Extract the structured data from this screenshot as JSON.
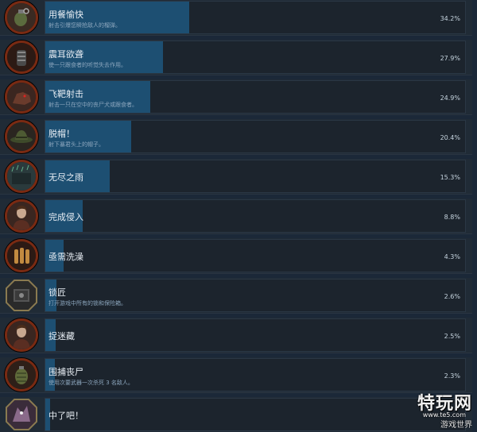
{
  "achievements": [
    {
      "name": "用餐愉快",
      "desc": "射击引爆您瞬抢敌人的榴弹。",
      "pct": "34.2%",
      "progress": 0.342,
      "icon": "hand-grenade-icon",
      "frame": "red"
    },
    {
      "name": "震耳欲聋",
      "desc": "使一只跟食者的听觉失去作用。",
      "pct": "27.9%",
      "progress": 0.279,
      "icon": "flash-grenade-icon",
      "frame": "red"
    },
    {
      "name": "飞靶射击",
      "desc": "射击一只在空中的丧尸犬或跟食者。",
      "pct": "24.9%",
      "progress": 0.249,
      "icon": "zombie-dog-icon",
      "frame": "red"
    },
    {
      "name": "脱帽！",
      "desc": "射下暴君头上的帽子。",
      "pct": "20.4%",
      "progress": 0.204,
      "icon": "hat-icon",
      "frame": "red"
    },
    {
      "name": "无尽之雨",
      "desc": "",
      "pct": "15.3%",
      "progress": 0.153,
      "icon": "rain-scene-icon",
      "frame": "red"
    },
    {
      "name": "完成侵入",
      "desc": "",
      "pct": "8.8%",
      "progress": 0.088,
      "icon": "character-portrait-icon",
      "frame": "red"
    },
    {
      "name": "亟需洗澡",
      "desc": "",
      "pct": "4.3%",
      "progress": 0.043,
      "icon": "bottles-icon",
      "frame": "red"
    },
    {
      "name": "锁匠",
      "desc": "打开游戏中所有的锁和保险箱。",
      "pct": "2.6%",
      "progress": 0.026,
      "icon": "safe-icon",
      "frame": "gold"
    },
    {
      "name": "捉迷藏",
      "desc": "",
      "pct": "2.5%",
      "progress": 0.025,
      "icon": "character-portrait-icon",
      "frame": "red"
    },
    {
      "name": "围捕丧尸",
      "desc": "使用次要武器一次杀死 3 名敌人。",
      "pct": "2.3%",
      "progress": 0.023,
      "icon": "grenade-icon",
      "frame": "red"
    },
    {
      "name": "中了吧！",
      "desc": "",
      "pct": "",
      "progress": 0.01,
      "icon": "monster-icon",
      "frame": "gold"
    }
  ],
  "watermark": {
    "title": "特玩网",
    "url": "www.te5.com",
    "sub": "游戏世界"
  },
  "colors": {
    "background": "#1b2838",
    "bar_fill": "#1d4f72",
    "frame_red": "#7a2a12",
    "frame_gold": "#8a7a50"
  }
}
